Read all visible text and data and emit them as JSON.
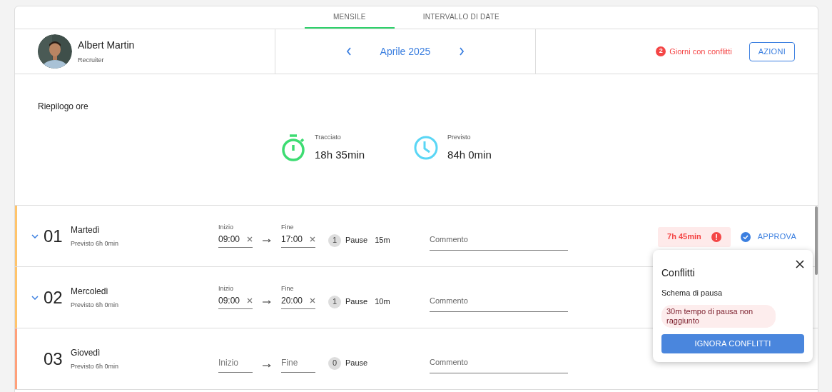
{
  "tabs": [
    {
      "label": "MENSILE",
      "selected": true
    },
    {
      "label": "INTERVALLO DI DATE",
      "selected": false
    }
  ],
  "user": {
    "name": "Albert Martin",
    "role": "Recruiter"
  },
  "period": {
    "label": "Aprile 2025"
  },
  "conflicts": {
    "count": "2",
    "label": "Giorni con conflitti"
  },
  "actions_button": "AZIONI",
  "summary": {
    "title": "Riepilogo ore",
    "stats": [
      {
        "kind": "tracked",
        "label": "Tracciato",
        "value": "18h 35min"
      },
      {
        "kind": "planned",
        "label": "Previsto",
        "value": "84h 0min"
      }
    ]
  },
  "days": [
    {
      "number": "01",
      "name": "Martedì",
      "expected": "Previsto 6h 0min",
      "expandable": true,
      "color": "#ffc46b",
      "start": {
        "label": "Inizio",
        "value": "09:00"
      },
      "end": {
        "label": "Fine",
        "value": "17:00"
      },
      "pause_count": "1",
      "pause_label": "Pause",
      "pause_duration": "15m",
      "comment_placeholder": "Commento",
      "total": "7h 45min",
      "conflict": true,
      "approve": "APPROVA"
    },
    {
      "number": "02",
      "name": "Mercoledì",
      "expected": "Previsto 6h 0min",
      "expandable": true,
      "color": "#ffc46b",
      "start": {
        "label": "Inizio",
        "value": "09:00"
      },
      "end": {
        "label": "Fine",
        "value": "20:00"
      },
      "pause_count": "1",
      "pause_label": "Pause",
      "pause_duration": "10m",
      "comment_placeholder": "Commento"
    },
    {
      "number": "03",
      "name": "Giovedì",
      "expected": "Previsto 6h 0min",
      "expandable": false,
      "color": "#ffa07a",
      "start": {
        "placeholder": "Inizio"
      },
      "end": {
        "placeholder": "Fine"
      },
      "pause_count": "0",
      "pause_label": "Pause",
      "comment_placeholder": "Commento"
    }
  ],
  "popover": {
    "title": "Conflitti",
    "section": "Schema di pausa",
    "message": "30m tempo di pausa non raggiunto",
    "button": "IGNORA CONFLITTI"
  }
}
